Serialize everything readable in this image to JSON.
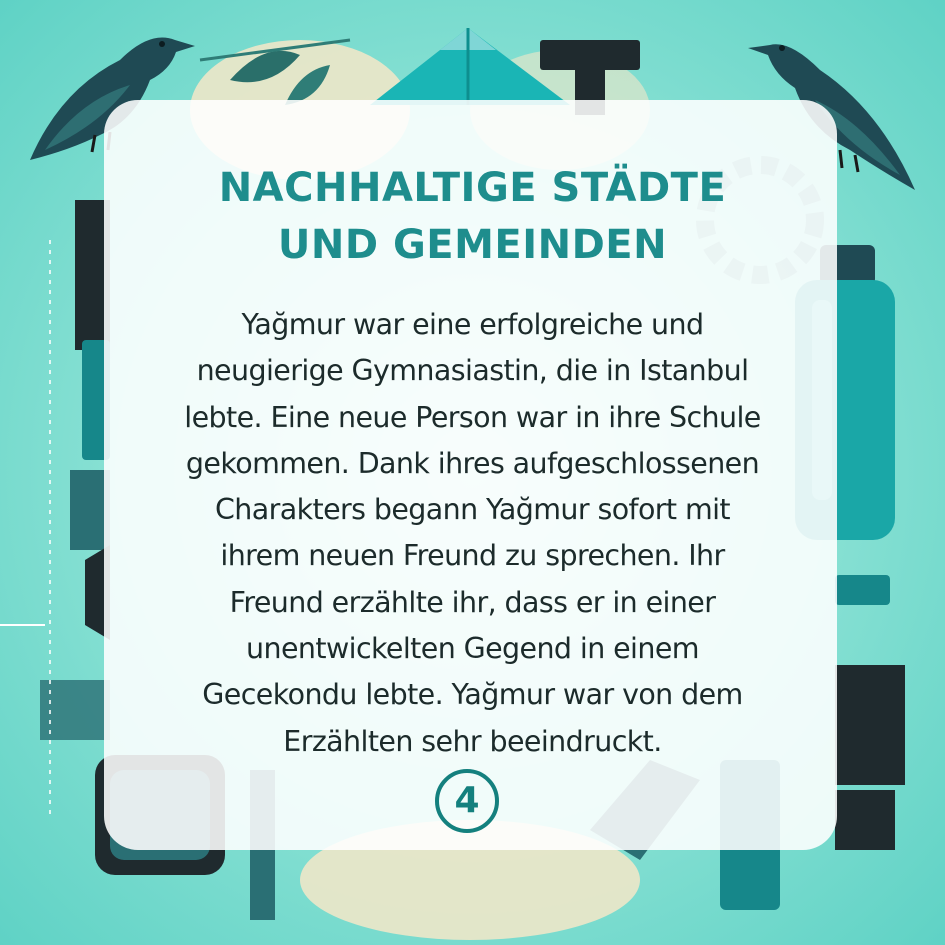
{
  "title": {
    "line1": "NACHHALTIGE STÄDTE",
    "line2": "UND GEMEINDEN"
  },
  "story": {
    "text": "Yağmur war eine erfolgreiche und\nneugierige Gymnasiastin, die in Istanbul\nlebte. Eine neue Person war in ihre Schule\ngekommen. Dank ihres aufgeschlossenen\nCharakters begann Yağmur sofort mit\nihrem neuen Freund zu sprechen. Ihr\nFreund erzählte ihr, dass er in einer\nunentwickelten Gegend in einem\nGecekondu lebte. Yağmur war von dem\nErzählten sehr beeindruckt."
  },
  "page": {
    "number": "4"
  },
  "colors": {
    "background": "#8fe3d6",
    "title": "#1e8d8d",
    "body_text": "#1c2b2b",
    "accent": "#14807e",
    "dark": "#1f3a40"
  },
  "icons": [
    "crow-icon-left",
    "crow-icon-right",
    "bottle-icon",
    "gear-icon",
    "leaf-icon"
  ]
}
